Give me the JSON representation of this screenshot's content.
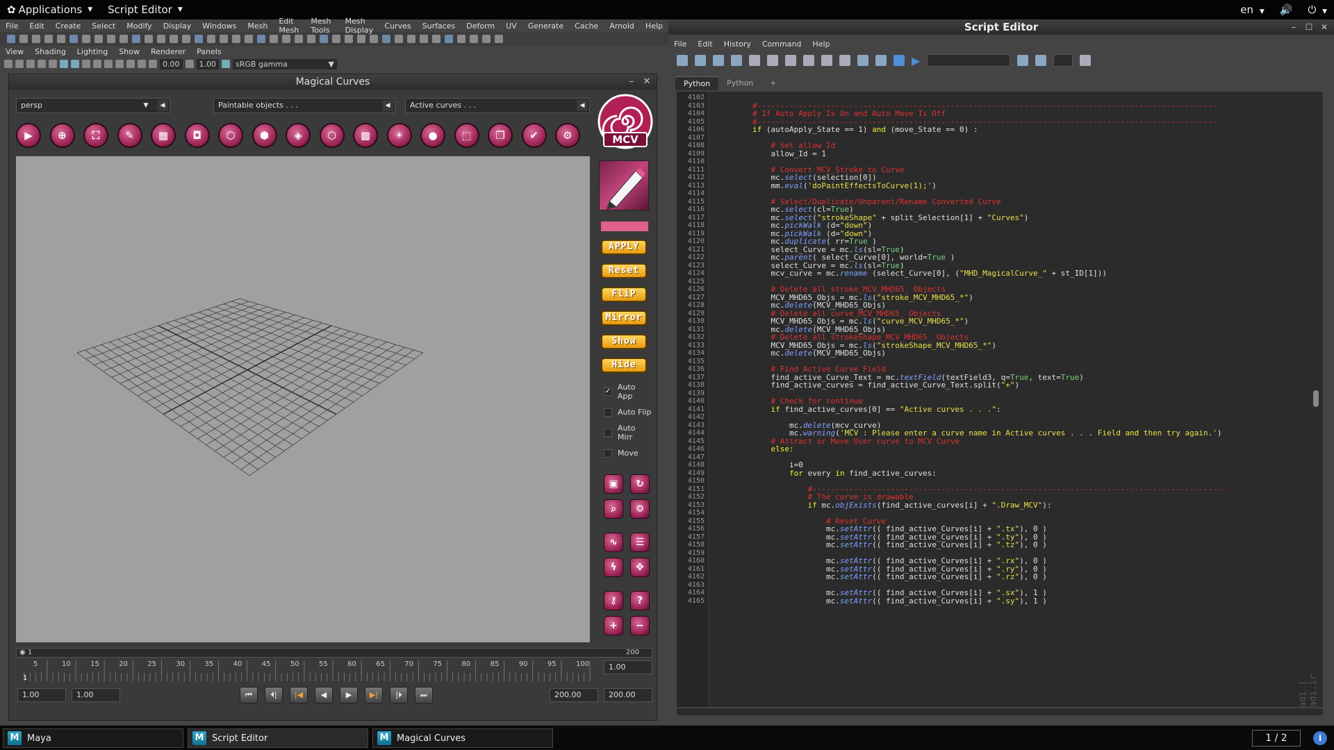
{
  "topbar": {
    "applications": "Applications",
    "script_editor": "Script Editor",
    "lang": "en"
  },
  "maya": {
    "menu": [
      "File",
      "Edit",
      "Create",
      "Select",
      "Modify",
      "Display",
      "Windows",
      "Mesh",
      "Edit Mesh",
      "Mesh Tools",
      "Mesh Display",
      "Curves",
      "Surfaces",
      "Deform",
      "UV",
      "Generate",
      "Cache",
      "Arnold",
      "Help"
    ],
    "panel_menu": [
      "View",
      "Shading",
      "Lighting",
      "Show",
      "Renderer",
      "Panels"
    ],
    "exposure": "0.00",
    "gamma": "1.00",
    "colorspace": "sRGB gamma"
  },
  "magical": {
    "title": "Magical Curves",
    "camera": "persp",
    "paintable": "Paintable objects . . .",
    "active_curves": "Active curves . . .",
    "logo_text": "MCV",
    "buttons": [
      "APPLY",
      "Reset",
      "FliP",
      "Mirror",
      "Show",
      "Hide"
    ],
    "checks": [
      {
        "label": "Auto App",
        "checked": true
      },
      {
        "label": "Auto Flip",
        "checked": false
      },
      {
        "label": "Auto Mirr",
        "checked": false
      },
      {
        "label": "Move",
        "checked": false
      }
    ],
    "range_start": "1",
    "range_end": "200",
    "ticks": [
      "5",
      "10",
      "15",
      "20",
      "25",
      "30",
      "35",
      "40",
      "45",
      "50",
      "55",
      "60",
      "65",
      "70",
      "75",
      "80",
      "85",
      "90",
      "95",
      "100"
    ],
    "current_frame": "1.00",
    "start_field": "1.00",
    "start_field2": "1.00",
    "end_field": "200.00",
    "end_field2": "200.00",
    "frame_marker": "1"
  },
  "script_editor": {
    "title": "Script Editor",
    "menu": [
      "File",
      "Edit",
      "History",
      "Command",
      "Help"
    ],
    "tabs": [
      "Python",
      "Python",
      "+"
    ],
    "watermark": "© Mehdi Ahmadi | www.mehdiahmadi.ir",
    "lines": [
      {
        "n": "4102",
        "t": ""
      },
      {
        "n": "4103",
        "t": "        #----------------------------------------------------------------------------------------------------",
        "c": "cm"
      },
      {
        "n": "4104",
        "t": "        # If Auto Apply Is On and Auto Move Is Off",
        "c": "cm"
      },
      {
        "n": "4105",
        "t": "        #----------------------------------------------------------------------------------------------------",
        "c": "cm"
      },
      {
        "n": "4106",
        "t": "        if (autoApply_State == 1) and (move_State == 0) :",
        "c": "pl"
      },
      {
        "n": "4107",
        "t": ""
      },
      {
        "n": "4108",
        "t": "            # Set allow_Id",
        "c": "cm"
      },
      {
        "n": "4109",
        "t": "            allow_Id = 1",
        "c": "pl"
      },
      {
        "n": "4110",
        "t": ""
      },
      {
        "n": "4111",
        "t": "            # Convert MCV_Stroke to Curve",
        "c": "cm"
      },
      {
        "n": "4112",
        "t": "            mc.select(selection[0])",
        "c": "pl"
      },
      {
        "n": "4113",
        "t": "            mm.eval('doPaintEffectsToCurve(1);')",
        "c": "pl"
      },
      {
        "n": "4114",
        "t": ""
      },
      {
        "n": "4115",
        "t": "            # Select/Duplicate/Unparent/Rename Converted Curve",
        "c": "cm"
      },
      {
        "n": "4116",
        "t": "            mc.select(cl=True)",
        "c": "pl"
      },
      {
        "n": "4117",
        "t": "            mc.select(\"strokeShape\" + split_Selection[1] + \"Curves\")",
        "c": "pl"
      },
      {
        "n": "4118",
        "t": "            mc.pickWalk (d=\"down\")",
        "c": "pl"
      },
      {
        "n": "4119",
        "t": "            mc.pickWalk (d=\"down\")",
        "c": "pl"
      },
      {
        "n": "4120",
        "t": "            mc.duplicate( rr=True )",
        "c": "pl"
      },
      {
        "n": "4121",
        "t": "            select_Curve = mc.ls(sl=True)",
        "c": "pl"
      },
      {
        "n": "4122",
        "t": "            mc.parent( select_Curve[0], world=True )",
        "c": "pl"
      },
      {
        "n": "4123",
        "t": "            select_Curve = mc.ls(sl=True)",
        "c": "pl"
      },
      {
        "n": "4124",
        "t": "            mcv_curve = mc.rename (select_Curve[0], (\"MHD_MagicalCurve_\" + st_ID[1]))",
        "c": "pl"
      },
      {
        "n": "4125",
        "t": ""
      },
      {
        "n": "4126",
        "t": "            # Delete all stroke_MCV_MHD65_ Objects",
        "c": "cm"
      },
      {
        "n": "4127",
        "t": "            MCV_MHD65_Objs = mc.ls(\"stroke_MCV_MHD65_*\")",
        "c": "pl"
      },
      {
        "n": "4128",
        "t": "            mc.delete(MCV_MHD65_Objs)",
        "c": "pl"
      },
      {
        "n": "4129",
        "t": "            # Delete all curve_MCV_MHD65_ Objects",
        "c": "cm"
      },
      {
        "n": "4130",
        "t": "            MCV_MHD65_Objs = mc.ls(\"curve_MCV_MHD65_*\")",
        "c": "pl"
      },
      {
        "n": "4131",
        "t": "            mc.delete(MCV_MHD65_Objs)",
        "c": "pl"
      },
      {
        "n": "4132",
        "t": "            # Delete all strokeShape_MCV_MHD65_ Objects",
        "c": "cm"
      },
      {
        "n": "4133",
        "t": "            MCV_MHD65_Objs = mc.ls(\"strokeShape_MCV_MHD65_*\")",
        "c": "pl"
      },
      {
        "n": "4134",
        "t": "            mc.delete(MCV_MHD65_Objs)",
        "c": "pl"
      },
      {
        "n": "4135",
        "t": ""
      },
      {
        "n": "4136",
        "t": "            # Find Active Curve Field",
        "c": "cm"
      },
      {
        "n": "4137",
        "t": "            find_active_Curve_Text = mc.textField(textField3, q=True, text=True)",
        "c": "pl"
      },
      {
        "n": "4138",
        "t": "            find_active_curves = find_active_Curve_Text.split(\"+\")",
        "c": "pl"
      },
      {
        "n": "4139",
        "t": ""
      },
      {
        "n": "4140",
        "t": "            # Check for continue",
        "c": "cm"
      },
      {
        "n": "4141",
        "t": "            if find_active_curves[0] == \"Active curves . . .\":",
        "c": "pl"
      },
      {
        "n": "4142",
        "t": ""
      },
      {
        "n": "4143",
        "t": "                mc.delete(mcv_curve)",
        "c": "pl"
      },
      {
        "n": "4144",
        "t": "                mc.warning('MCV : Please enter a curve name in Active curves . . . Field and then try again.')",
        "c": "pl"
      },
      {
        "n": "4145",
        "t": "            # Attract or Move User curve to MCV Curve",
        "c": "cm"
      },
      {
        "n": "4146",
        "t": "            else:",
        "c": "kw"
      },
      {
        "n": "4147",
        "t": ""
      },
      {
        "n": "4148",
        "t": "                i=0",
        "c": "pl"
      },
      {
        "n": "4149",
        "t": "                for every in find_active_curves:",
        "c": "pl"
      },
      {
        "n": "4150",
        "t": ""
      },
      {
        "n": "4151",
        "t": "                    #------------------------------------------------------------------------------------------",
        "c": "cm"
      },
      {
        "n": "4152",
        "t": "                    # The curve is drawable",
        "c": "cm"
      },
      {
        "n": "4153",
        "t": "                    if mc.objExists(find_active_curves[i] + \".Draw_MCV\"):",
        "c": "pl"
      },
      {
        "n": "4154",
        "t": ""
      },
      {
        "n": "4155",
        "t": "                        # Reset Curve",
        "c": "cm"
      },
      {
        "n": "4156",
        "t": "                        mc.setAttr(( find_active_Curves[i] + \".tx\"), 0 )",
        "c": "pl"
      },
      {
        "n": "4157",
        "t": "                        mc.setAttr(( find_active_Curves[i] + \".ty\"), 0 )",
        "c": "pl"
      },
      {
        "n": "4158",
        "t": "                        mc.setAttr(( find_active_Curves[i] + \".tz\"), 0 )",
        "c": "pl"
      },
      {
        "n": "4159",
        "t": ""
      },
      {
        "n": "4160",
        "t": "                        mc.setAttr(( find_active_Curves[i] + \".rx\"), 0 )",
        "c": "pl"
      },
      {
        "n": "4161",
        "t": "                        mc.setAttr(( find_active_Curves[i] + \".ry\"), 0 )",
        "c": "pl"
      },
      {
        "n": "4162",
        "t": "                        mc.setAttr(( find_active_Curves[i] + \".rz\"), 0 )",
        "c": "pl"
      },
      {
        "n": "4163",
        "t": ""
      },
      {
        "n": "4164",
        "t": "                        mc.setAttr(( find_active_Curves[i] + \".sx\"), 1 )",
        "c": "pl"
      },
      {
        "n": "4165",
        "t": "                        mc.setAttr(( find_active_Curves[i] + \".sy\"), 1 )",
        "c": "pl"
      }
    ]
  },
  "taskbar": {
    "tasks": [
      "Maya",
      "Script Editor",
      "Magical Curves"
    ],
    "pager": "1 / 2"
  }
}
